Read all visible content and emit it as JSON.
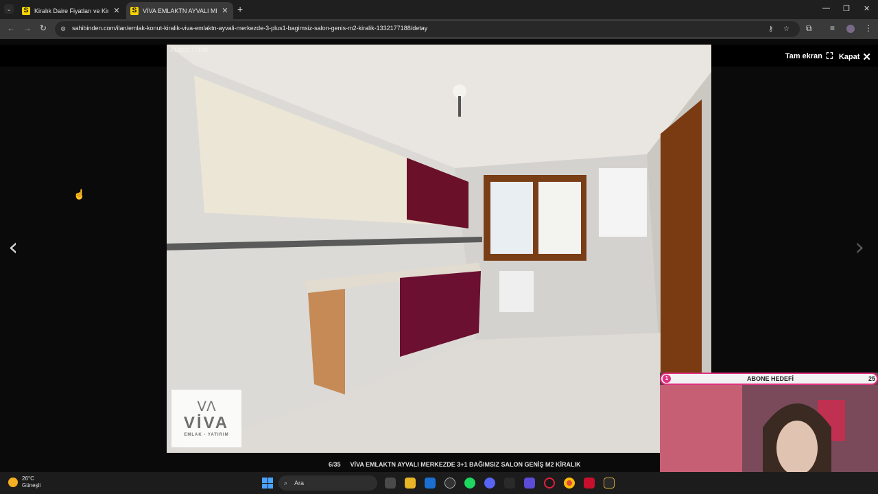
{
  "browser": {
    "tabs": [
      {
        "favicon": "S",
        "title": "Kiralık Daire Fiyatları ve Kiralık",
        "active": false
      },
      {
        "favicon": "S",
        "title": "VİVA EMLAKTN AYVALI MERKEZ",
        "active": true
      }
    ],
    "new_tab": "+",
    "url": "sahibinden.com/ilan/emlak-konut-kiralik-viva-emlaktn-ayvali-merkezde-3-plus1-bagimsiz-salon-genis-m2-kiralik-1332177188/detay"
  },
  "viewer": {
    "fullscreen_label": "Tam ekran",
    "close_label": "Kapat",
    "listing_id": "#1332177188",
    "counter": "6/35",
    "caption": "VİVA EMLAKTN AYVALI MERKEZDE 3+1 BAĞIMSIZ SALON GENİŞ M2 KİRALIK",
    "watermark": {
      "name": "VİVA",
      "sub": "EMLAK - YATIRIM"
    }
  },
  "taskbar": {
    "temperature": "26°C",
    "condition": "Güneşli",
    "search_placeholder": "Ara"
  },
  "stream_overlay": {
    "goal_index": "1",
    "goal_title": "ABONE HEDEFİ",
    "goal_target": "25"
  }
}
